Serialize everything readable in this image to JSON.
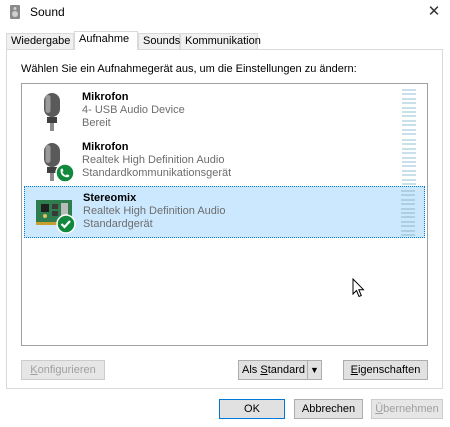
{
  "window": {
    "title": "Sound",
    "close_glyph": "✕"
  },
  "tabs": [
    {
      "label": "Wiedergabe",
      "active": false
    },
    {
      "label": "Aufnahme",
      "active": true
    },
    {
      "label": "Sounds",
      "active": false
    },
    {
      "label": "Kommunikation",
      "active": false
    }
  ],
  "instruction": "Wählen Sie ein Aufnahmegerät aus, um die Einstellungen zu ändern:",
  "devices": [
    {
      "name": "Mikrofon",
      "line2": "4- USB Audio Device",
      "line3": "Bereit",
      "icon": "microphone-icon",
      "badge": null,
      "selected": false
    },
    {
      "name": "Mikrofon",
      "line2": "Realtek High Definition Audio",
      "line3": "Standardkommunikationsgerät",
      "icon": "microphone-icon",
      "badge": "phone-badge-icon",
      "selected": false
    },
    {
      "name": "Stereomix",
      "line2": "Realtek High Definition Audio",
      "line3": "Standardgerät",
      "icon": "sound-card-icon",
      "badge": "check-badge-icon",
      "selected": true
    }
  ],
  "buttons": {
    "configure": {
      "prefix": "",
      "mnemonic": "K",
      "rest": "onfigurieren",
      "enabled": false
    },
    "set_default": {
      "prefix": "Als ",
      "mnemonic": "S",
      "rest": "tandard",
      "arrow": "▼"
    },
    "properties": {
      "prefix": "",
      "mnemonic": "E",
      "rest": "igenschaften"
    },
    "ok": {
      "label": "OK"
    },
    "cancel": {
      "label": "Abbrechen"
    },
    "apply": {
      "prefix": "",
      "mnemonic": "Ü",
      "rest": "bernehmen",
      "enabled": false
    }
  },
  "colors": {
    "selection": "#cce8ff",
    "accent": "#0078d7",
    "badge_green": "#10893e",
    "meter": "#c9e0ea"
  }
}
